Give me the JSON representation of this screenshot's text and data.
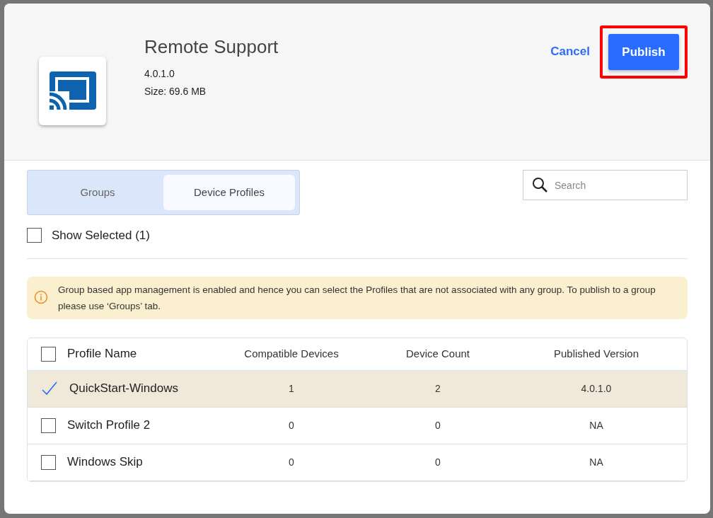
{
  "app": {
    "title": "Remote Support",
    "version": "4.0.1.0",
    "size": "Size: 69.6 MB"
  },
  "actions": {
    "cancel": "Cancel",
    "publish": "Publish"
  },
  "tabs": [
    {
      "label": "Groups",
      "selected": false
    },
    {
      "label": "Device Profiles",
      "selected": true
    }
  ],
  "search": {
    "placeholder": "Search"
  },
  "show_selected": {
    "label": "Show Selected (1)",
    "checked": false
  },
  "notice": "Group based app management is enabled and hence you can select the Profiles that are not associated with any group. To publish to a group please use ‘Groups’ tab.",
  "table": {
    "select_all": false,
    "columns": [
      "Profile Name",
      "Compatible Devices",
      "Device Count",
      "Published Version"
    ],
    "rows": [
      {
        "checked": true,
        "cells": [
          "QuickStart-Windows",
          "1",
          "2",
          "4.0.1.0"
        ]
      },
      {
        "checked": false,
        "cells": [
          "Switch Profile 2",
          "0",
          "0",
          "NA"
        ]
      },
      {
        "checked": false,
        "cells": [
          "Windows Skip",
          "0",
          "0",
          "NA"
        ]
      }
    ]
  }
}
